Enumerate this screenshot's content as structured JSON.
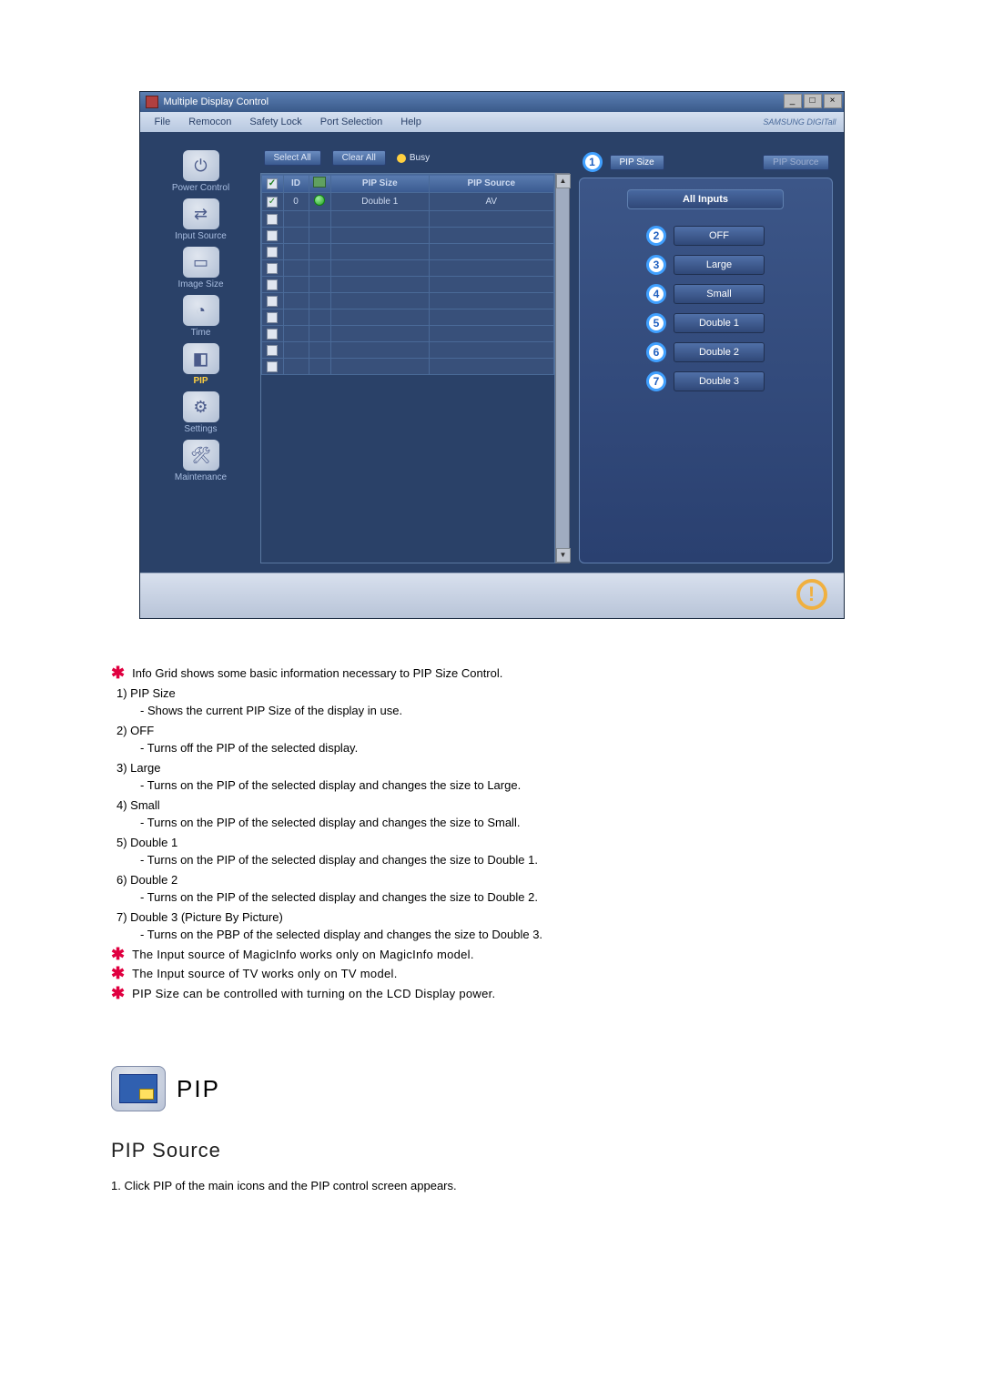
{
  "app": {
    "title": "Multiple Display Control",
    "brand": "SAMSUNG DIGITall"
  },
  "menu": {
    "file": "File",
    "remocon": "Remocon",
    "safety": "Safety Lock",
    "port": "Port Selection",
    "help": "Help"
  },
  "toolbar": {
    "selectAll": "Select All",
    "clearAll": "Clear All",
    "busy": "Busy"
  },
  "sidebar": {
    "power": "Power Control",
    "input": "Input Source",
    "image": "Image Size",
    "time": "Time",
    "pip": "PIP",
    "settings": "Settings",
    "maintenance": "Maintenance"
  },
  "grid": {
    "headers": {
      "id": "ID",
      "pipSize": "PIP Size",
      "pipSource": "PIP Source"
    },
    "row0": {
      "id": "0",
      "pipSize": "Double 1",
      "pipSource": "AV"
    }
  },
  "rightpanel": {
    "callout1": "1",
    "pipSize": "PIP Size",
    "pipSource": "PIP Source",
    "allInputs": "All Inputs",
    "options": {
      "n2": "2",
      "l2": "OFF",
      "n3": "3",
      "l3": "Large",
      "n4": "4",
      "l4": "Small",
      "n5": "5",
      "l5": "Double 1",
      "n6": "6",
      "l6": "Double 2",
      "n7": "7",
      "l7": "Double 3"
    }
  },
  "explain": {
    "intro": "Info Grid shows some basic information necessary to PIP Size Control.",
    "i1_t": "1)  PIP Size",
    "i1_d": "- Shows the current PIP Size of the display in use.",
    "i2_t": "2)  OFF",
    "i2_d": "- Turns off the PIP of the selected display.",
    "i3_t": "3)  Large",
    "i3_d": "- Turns on the PIP of the selected display and changes the size to Large.",
    "i4_t": "4)  Small",
    "i4_d": "- Turns on the PIP of the selected display and changes the size to Small.",
    "i5_t": "5)  Double 1",
    "i5_d": "- Turns on the PIP of the selected display and changes the size to Double 1.",
    "i6_t": "6)  Double 2",
    "i6_d": "- Turns on the PIP of the selected display and changes the size to Double 2.",
    "i7_t": "7)  Double 3 (Picture By Picture)",
    "i7_d": "- Turns on the PBP of the selected display and changes the size to Double 3.",
    "note1": "The Input source of MagicInfo works only on MagicInfo model.",
    "note2": "The Input source of TV works only on TV model.",
    "note3": "PIP Size can be controlled with turning on the LCD Display power."
  },
  "section": {
    "heading": "PIP",
    "subheading": "PIP Source",
    "step1": "1.  Click PIP of the main icons and the PIP control screen appears."
  }
}
